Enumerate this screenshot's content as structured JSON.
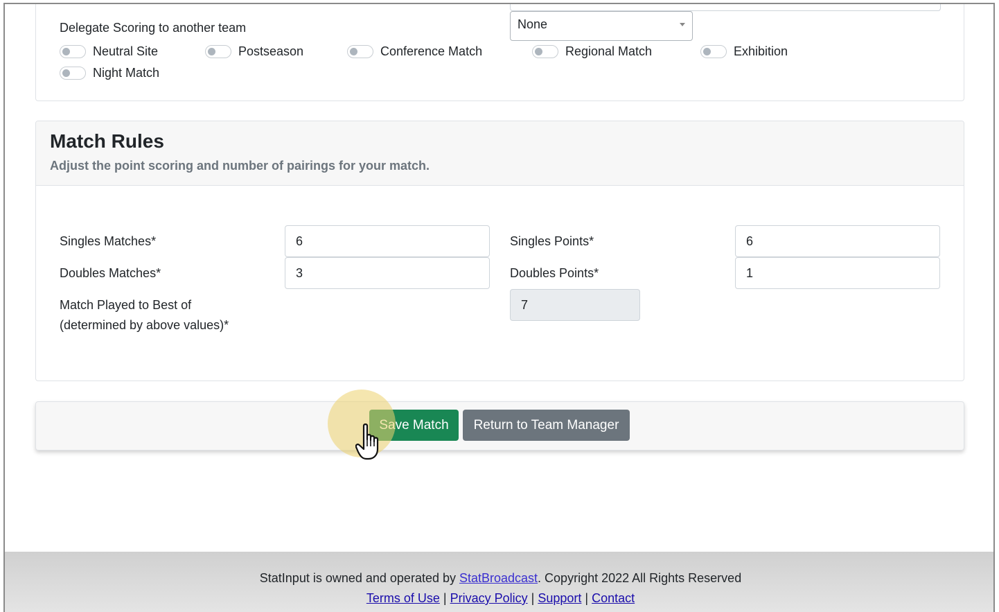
{
  "delegate": {
    "label": "Delegate Scoring to another team",
    "select_value": "None"
  },
  "toggles": [
    {
      "label": "Neutral Site",
      "on": false
    },
    {
      "label": "Postseason",
      "on": false
    },
    {
      "label": "Conference Match",
      "on": false
    },
    {
      "label": "Regional Match",
      "on": false
    },
    {
      "label": "Exhibition",
      "on": false
    },
    {
      "label": "Night Match",
      "on": false
    }
  ],
  "match_rules": {
    "title": "Match Rules",
    "subtitle": "Adjust the point scoring and number of pairings for your match.",
    "singles_matches_label": "Singles Matches*",
    "singles_matches_value": "6",
    "singles_points_label": "Singles Points*",
    "singles_points_value": "6",
    "doubles_matches_label": "Doubles Matches*",
    "doubles_matches_value": "3",
    "doubles_points_label": "Doubles Points*",
    "doubles_points_value": "1",
    "best_of_label_line1": "Match Played to Best of",
    "best_of_label_line2": "(determined by above values)*",
    "best_of_value": "7"
  },
  "actions": {
    "save_label": "Save Match",
    "return_label": "Return to Team Manager"
  },
  "footer": {
    "text_before": "StatInput is owned and operated by ",
    "link_company": "StatBroadcast",
    "text_after": ". Copyright 2022 All Rights Reserved",
    "links": [
      "Terms of Use",
      "Privacy Policy",
      "Support",
      "Contact"
    ],
    "separator": "|"
  }
}
